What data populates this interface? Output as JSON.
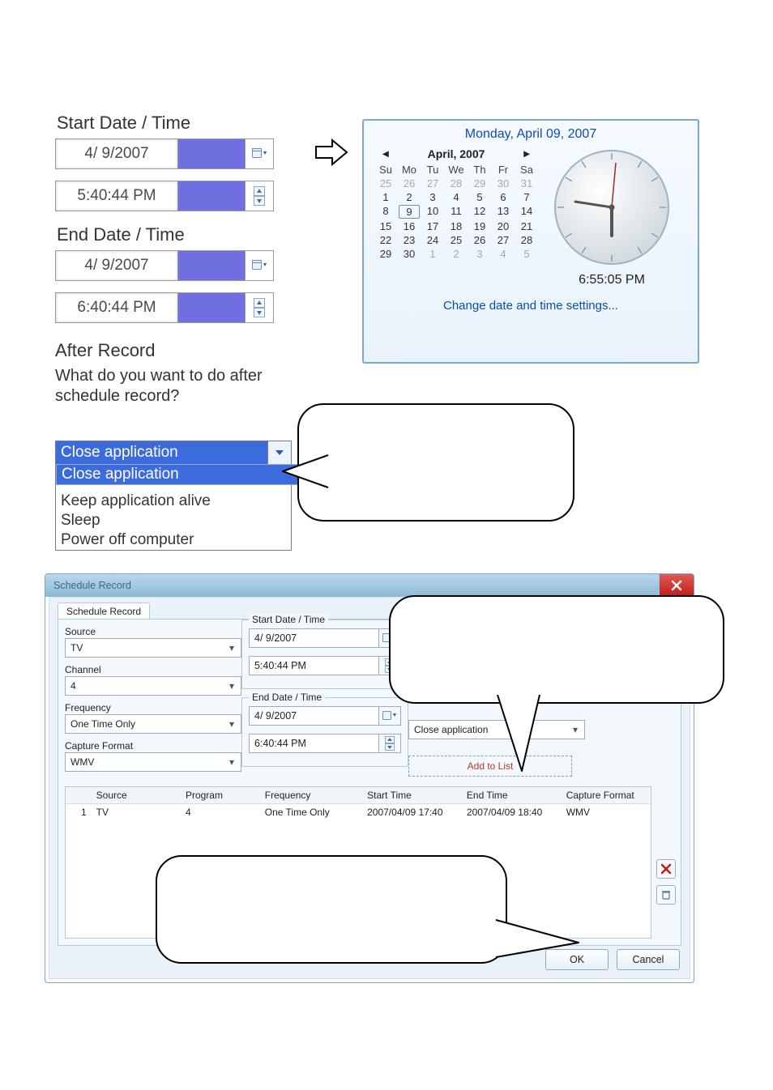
{
  "dt_block": {
    "start_title": "Start Date / Time",
    "end_title": "End Date / Time",
    "start_date": "4/  9/2007",
    "start_time": "5:40:44 PM",
    "end_date": "4/  9/2007",
    "end_time": "6:40:44 PM"
  },
  "after_record": {
    "title": "After Record",
    "question": "What do you want to do after schedule record?",
    "selected": "Close application",
    "options": [
      "Close application",
      "Keep application alive",
      "Sleep",
      "Power off computer"
    ]
  },
  "datetime_popup": {
    "heading": "Monday, April 09, 2007",
    "month_label": "April, 2007",
    "dow": [
      "Su",
      "Mo",
      "Tu",
      "We",
      "Th",
      "Fr",
      "Sa"
    ],
    "weeks": [
      [
        25,
        26,
        27,
        28,
        29,
        30,
        31
      ],
      [
        1,
        2,
        3,
        4,
        5,
        6,
        7
      ],
      [
        8,
        9,
        10,
        11,
        12,
        13,
        14
      ],
      [
        15,
        16,
        17,
        18,
        19,
        20,
        21
      ],
      [
        22,
        23,
        24,
        25,
        26,
        27,
        28
      ],
      [
        29,
        30,
        1,
        2,
        3,
        4,
        5
      ]
    ],
    "dim_first_row": true,
    "dim_last_row_from_col": 2,
    "today_cell": {
      "row": 2,
      "col": 1
    },
    "clock_time": "6:55:05 PM",
    "link": "Change date and time settings..."
  },
  "sched_window": {
    "title": "Schedule Record",
    "tab": "Schedule Record",
    "form": {
      "source_label": "Source",
      "source_value": "TV",
      "channel_label": "Channel",
      "channel_value": "4",
      "frequency_label": "Frequency",
      "frequency_value": "One Time Only",
      "format_label": "Capture Format",
      "format_value": "WMV",
      "start_legend": "Start Date / Time",
      "start_date": "4/  9/2007",
      "start_time": "5:40:44 PM",
      "end_legend": "End Date / Time",
      "end_date": "4/  9/2007",
      "end_time": "6:40:44 PM",
      "after_selected": "Close application",
      "add_button": "Add to List"
    },
    "list": {
      "headers": [
        "",
        "Source",
        "Program",
        "Frequency",
        "Start Time",
        "End Time",
        "Capture Format"
      ],
      "rows": [
        {
          "idx": "1",
          "source": "TV",
          "program": "4",
          "frequency": "One Time Only",
          "start": "2007/04/09 17:40",
          "end": "2007/04/09 18:40",
          "format": "WMV"
        }
      ]
    },
    "buttons": {
      "ok": "OK",
      "cancel": "Cancel"
    }
  }
}
